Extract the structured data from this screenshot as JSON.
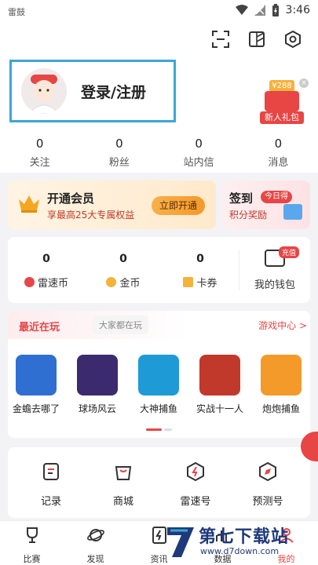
{
  "status_bar": {
    "carrier": "雷鼓",
    "time": "3:46"
  },
  "header": {
    "login_label": "登录/注册",
    "gift": {
      "amount": "¥288",
      "label": "新人礼包"
    }
  },
  "stats": [
    {
      "value": "0",
      "label": "关注"
    },
    {
      "value": "0",
      "label": "粉丝"
    },
    {
      "value": "0",
      "label": "站内信"
    },
    {
      "value": "0",
      "label": "消息"
    }
  ],
  "vip_promo": {
    "title": "开通会员",
    "subtitle": "享最高25大专属权益",
    "button": "立即开通"
  },
  "signin_promo": {
    "title": "签到",
    "badge": "今日得",
    "subtitle": "积分奖励"
  },
  "wallet": {
    "items": [
      {
        "value": "0",
        "label": "雷速币",
        "icon": "leisu-coin-icon",
        "color": "#e84545"
      },
      {
        "value": "0",
        "label": "金币",
        "icon": "gold-coin-icon",
        "color": "#f5b23a"
      },
      {
        "value": "0",
        "label": "卡券",
        "icon": "coupon-icon",
        "color": "#f5b23a"
      }
    ],
    "my_wallet_label": "我的钱包",
    "recharge_badge": "充值"
  },
  "games": {
    "tab_recent": "最近在玩",
    "tab_popular": "大家都在玩",
    "more_label": "游戏中心 >",
    "items": [
      {
        "name": "金蟾去哪了",
        "color": "#2f6fd1"
      },
      {
        "name": "球场风云",
        "color": "#3b2a6e"
      },
      {
        "name": "大神捕鱼",
        "color": "#1e9ad6"
      },
      {
        "name": "实战十一人",
        "color": "#c0392b"
      },
      {
        "name": "炮炮捕鱼",
        "color": "#f39a2a"
      }
    ]
  },
  "tools": [
    {
      "label": "记录",
      "icon": "record-icon"
    },
    {
      "label": "商城",
      "icon": "shop-bag-icon"
    },
    {
      "label": "雷速号",
      "icon": "leisu-hexagon-icon"
    },
    {
      "label": "预测号",
      "icon": "compass-icon"
    }
  ],
  "tabbar": [
    {
      "label": "比赛",
      "icon": "trophy-icon"
    },
    {
      "label": "发现",
      "icon": "planet-icon"
    },
    {
      "label": "资讯",
      "icon": "news-icon"
    },
    {
      "label": "数据",
      "icon": "data-icon"
    },
    {
      "label": "我的",
      "icon": "profile-icon",
      "active": true
    }
  ],
  "watermark": {
    "brand": "第七下载站",
    "url": "www.d7down.com"
  },
  "colors": {
    "accent": "#e84545",
    "highlight_border": "#3aa7d6",
    "brand_blue": "#1f3a7a"
  }
}
